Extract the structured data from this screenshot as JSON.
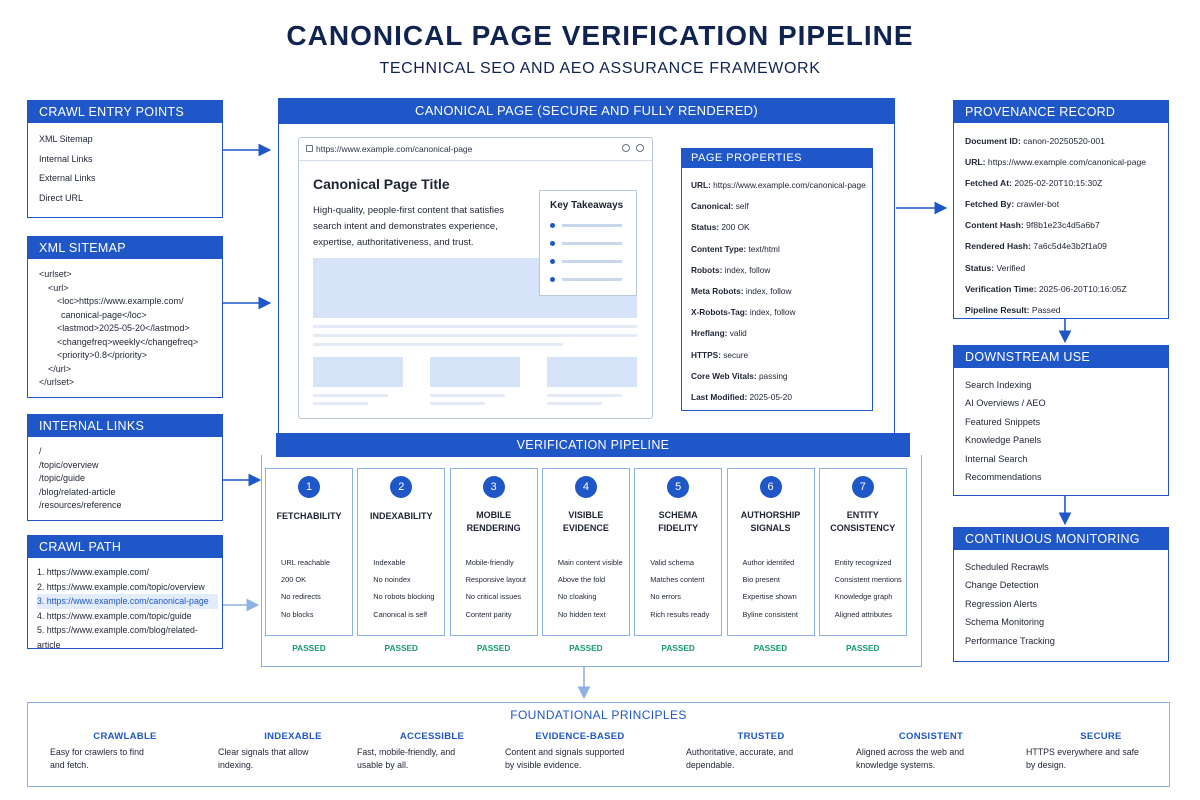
{
  "title": "CANONICAL PAGE VERIFICATION PIPELINE",
  "subtitle": "TECHNICAL SEO AND AEO ASSURANCE FRAMEWORK",
  "crawl_entry": {
    "title": "CRAWL ENTRY POINTS",
    "items": [
      "XML Sitemap",
      "Internal Links",
      "External Links",
      "Direct URL"
    ]
  },
  "xml_sitemap": {
    "title": "XML SITEMAP",
    "lines": [
      "<urlset>",
      "<url>",
      "<loc>https://www.example.com/",
      "canonical-page</loc>",
      "<lastmod>2025-05-20</lastmod>",
      "<changefreq>weekly</changefreq>",
      "<priority>0.8</priority>",
      "</url>",
      "</urlset>"
    ]
  },
  "internal_links": {
    "title": "INTERNAL LINKS",
    "items": [
      "/",
      "/topic/overview",
      "/topic/guide",
      "/blog/related-article",
      "/resources/reference"
    ]
  },
  "crawl_path": {
    "title": "CRAWL PATH",
    "items": [
      "1. https://www.example.com/",
      "2. https://www.example.com/topic/overview",
      "3. https://www.example.com/canonical-page",
      "4. https://www.example.com/topic/guide",
      "5. https://www.example.com/blog/related-article"
    ],
    "highlighted_index": 2
  },
  "canonical_page": {
    "title": "CANONICAL PAGE (SECURE AND FULLY RENDERED)",
    "url": "https://www.example.com/canonical-page",
    "page_title": "Canonical Page Title",
    "page_description": "High-quality, people-first content that satisfies search intent and demonstrates experience, expertise, authoritativeness, and trust.",
    "takeaways_title": "Key Takeaways"
  },
  "page_properties": {
    "title": "PAGE PROPERTIES",
    "rows": [
      {
        "label": "URL:",
        "value": "https://www.example.com/canonical-page"
      },
      {
        "label": "Canonical:",
        "value": "self"
      },
      {
        "label": "Status:",
        "value": "200 OK"
      },
      {
        "label": "Content Type:",
        "value": "text/html"
      },
      {
        "label": "Robots:",
        "value": "index, follow"
      },
      {
        "label": "Meta Robots:",
        "value": "index, follow"
      },
      {
        "label": "X-Robots-Tag:",
        "value": "index, follow"
      },
      {
        "label": "Hreflang:",
        "value": "valid"
      },
      {
        "label": "HTTPS:",
        "value": "secure"
      },
      {
        "label": "Core Web Vitals:",
        "value": "passing"
      },
      {
        "label": "Last Modified:",
        "value": "2025-05-20"
      }
    ]
  },
  "pipeline": {
    "title": "VERIFICATION PIPELINE",
    "steps": [
      {
        "num": "1",
        "title": [
          "FETCHABILITY"
        ],
        "items": [
          "URL reachable",
          "200 OK",
          "No redirects",
          "No blocks"
        ],
        "status": "PASSED"
      },
      {
        "num": "2",
        "title": [
          "INDEXABILITY"
        ],
        "items": [
          "Indexable",
          "No noindex",
          "No robots blocking",
          "Canonical is self"
        ],
        "status": "PASSED"
      },
      {
        "num": "3",
        "title": [
          "MOBILE",
          "RENDERING"
        ],
        "items": [
          "Mobile-friendly",
          "Responsive layout",
          "No critical issues",
          "Content parity"
        ],
        "status": "PASSED"
      },
      {
        "num": "4",
        "title": [
          "VISIBLE",
          "EVIDENCE"
        ],
        "items": [
          "Main content visible",
          "Above the fold",
          "No cloaking",
          "No hidden text"
        ],
        "status": "PASSED"
      },
      {
        "num": "5",
        "title": [
          "SCHEMA",
          "FIDELITY"
        ],
        "items": [
          "Valid schema",
          "Matches content",
          "No errors",
          "Rich results ready"
        ],
        "status": "PASSED"
      },
      {
        "num": "6",
        "title": [
          "AUTHORSHIP",
          "SIGNALS"
        ],
        "items": [
          "Author identifed",
          "Bio present",
          "Expertise shown",
          "Byline consistent"
        ],
        "status": "PASSED"
      },
      {
        "num": "7",
        "title": [
          "ENTITY",
          "CONSISTENCY"
        ],
        "items": [
          "Entity recognized",
          "Consistent mentions",
          "Knowledge graph",
          "Aligned attributes"
        ],
        "status": "PASSED"
      }
    ]
  },
  "provenance": {
    "title": "PROVENANCE RECORD",
    "rows": [
      {
        "label": "Document ID:",
        "value": "canon-20250520-001"
      },
      {
        "label": "URL:",
        "value": "https://www.example.com/canonical-page"
      },
      {
        "label": "Fetched At:",
        "value": "2025-02-20T10:15:30Z"
      },
      {
        "label": "Fetched By:",
        "value": "crawler-bot"
      },
      {
        "label": "Content Hash:",
        "value": "9f8b1e23c4d5a6b7"
      },
      {
        "label": "Rendered Hash:",
        "value": "7a6c5d4e3b2f1a09"
      },
      {
        "label": "Status:",
        "value": "Verified"
      },
      {
        "label": "Verification Time:",
        "value": "2025-06-20T10:16:05Z"
      },
      {
        "label": "Pipeline Result:",
        "value": "Passed"
      }
    ]
  },
  "downstream": {
    "title": "DOWNSTREAM USE",
    "items": [
      "Search Indexing",
      "AI Overviews / AEO",
      "Featured Snippets",
      "Knowledge Panels",
      "Internal Search",
      "Recommendations"
    ]
  },
  "monitoring": {
    "title": "CONTINUOUS MONITORING",
    "items": [
      "Scheduled Recrawls",
      "Change Detection",
      "Regression Alerts",
      "Schema Monitoring",
      "Performance Tracking"
    ]
  },
  "foundational": {
    "title": "FOUNDATIONAL PRINCIPLES",
    "principles": [
      {
        "title": "CRAWLABLE",
        "desc": [
          "Easy for crawlers to find",
          "and fetch."
        ]
      },
      {
        "title": "INDEXABLE",
        "desc": [
          "Clear signals that allow",
          "indexing."
        ]
      },
      {
        "title": "ACCESSIBLE",
        "desc": [
          "Fast, mobile-friendly, and",
          "usable by all."
        ]
      },
      {
        "title": "EVIDENCE-BASED",
        "desc": [
          "Content and signals supported",
          "by visible evidence."
        ]
      },
      {
        "title": "TRUSTED",
        "desc": [
          "Authoritative, accurate, and",
          "dependable."
        ]
      },
      {
        "title": "CONSISTENT",
        "desc": [
          "Aligned across the web and",
          "knowledge systems."
        ]
      },
      {
        "title": "SECURE",
        "desc": [
          "HTTPS everywhere and safe",
          "by design."
        ]
      }
    ]
  },
  "colors": {
    "primary": "#1f57c8",
    "title_navy": "#10244f",
    "passed_green": "#1b9a6b",
    "highlight": "#e3ecfb"
  },
  "icons": [
    "lock-icon",
    "refresh-icon",
    "menu-icon",
    "arrow-icon"
  ]
}
